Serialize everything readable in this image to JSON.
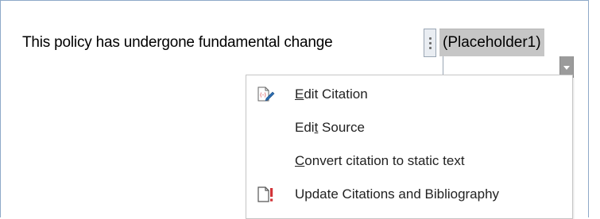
{
  "document": {
    "body_text": "This policy has undergone fundamental change",
    "citation_text": "(Placeholder1)"
  },
  "context_menu": {
    "items": [
      {
        "pre": "",
        "accel": "E",
        "post": "dit Citation",
        "icon": "edit-citation-icon"
      },
      {
        "pre": "Edi",
        "accel": "t",
        "post": " Source",
        "icon": ""
      },
      {
        "pre": "",
        "accel": "C",
        "post": "onvert citation to static text",
        "icon": ""
      },
      {
        "pre": "Update Citations and Bibliography",
        "accel": "",
        "post": "",
        "icon": "update-document-icon"
      }
    ]
  },
  "colors": {
    "citation_highlight": "#c6c6c6",
    "dropdown_button": "#9b9b9b",
    "frame_border": "#8ea9c8",
    "icon_red": "#d13438"
  }
}
